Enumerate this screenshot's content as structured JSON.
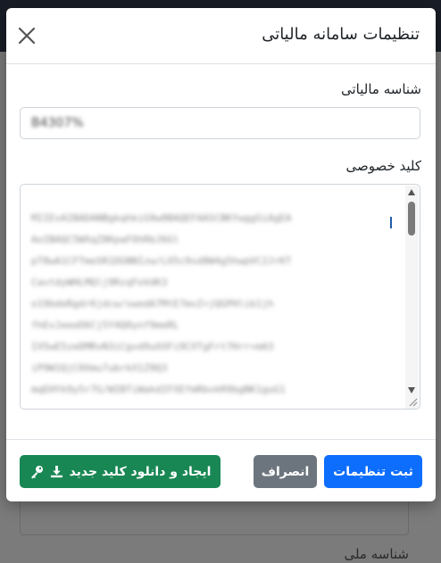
{
  "background": {
    "field_label": "شناسه ملی"
  },
  "modal": {
    "title": "تنظیمات سامانه مالیاتی",
    "tax_id": {
      "label": "شناسه مالیاتی",
      "value": "B4307%"
    },
    "private_key": {
      "label": "کلید خصوصی",
      "lines": [
        "MIIEvAIBADANBgkqhkiG9w0BAQEFAASCBKYwggSiAgEA",
        "AoIBAQC5WXqZ8KpaFOhRbJ6Gl",
        "pT8wA1CFTmeSR1DGNNIzw/LO5c9sd8W4g5hwpVC2JrKT",
        "CavtdyWHLMQlj9RzqFoVdK3",
        "o19bdeRgdr6jdcw/swedA7MtE7mvZ+jQGPHlib1jh",
        "fhEvJeeeD6Cj5Y4Q0ynf9meRL",
        "IX5wE5zeDMRvN3iCgvd9uXXFi9CXTgFrt7Hrr+mA3",
        "iP9W1QjC0Xmu7ubrkX1Z9Q3",
        "mqEHYk9y5r7G/WIBTiWakdIFXEfmRbvkR9bgNK1guG1"
      ]
    },
    "buttons": {
      "save": "ثبت تنظیمات",
      "cancel": "انصراف",
      "generate": "ایجاد و دانلود کلید جدید"
    }
  },
  "colors": {
    "primary": "#0d6efd",
    "secondary": "#6c757d",
    "success": "#198754"
  },
  "icons": {
    "close": "close-icon",
    "key": "key-icon",
    "download": "download-icon"
  }
}
